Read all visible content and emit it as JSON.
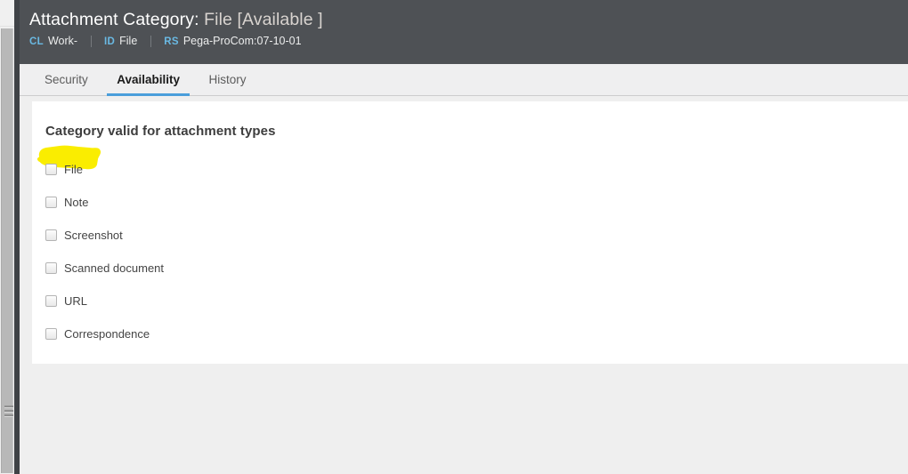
{
  "header": {
    "title_prefix": "Attachment Category:",
    "title_object": "File [Available ]",
    "meta": [
      {
        "key": "CL",
        "value": "Work-"
      },
      {
        "key": "ID",
        "value": "File"
      },
      {
        "key": "RS",
        "value": "Pega-ProCom:07-10-01"
      }
    ]
  },
  "tabs": [
    {
      "label": "Security",
      "active": false
    },
    {
      "label": "Availability",
      "active": true
    },
    {
      "label": "History",
      "active": false
    }
  ],
  "main": {
    "section_heading": "Category valid for attachment types",
    "attachment_types": [
      {
        "label": "File",
        "checked": false,
        "highlighted": true
      },
      {
        "label": "Note",
        "checked": false,
        "highlighted": false
      },
      {
        "label": "Screenshot",
        "checked": false,
        "highlighted": false
      },
      {
        "label": "Scanned document",
        "checked": false,
        "highlighted": false
      },
      {
        "label": "URL",
        "checked": false,
        "highlighted": false
      },
      {
        "label": "Correspondence",
        "checked": false,
        "highlighted": false
      }
    ]
  },
  "annotation": {
    "type": "marker-highlight",
    "color": "#faed00",
    "target": "File"
  },
  "colors": {
    "header_bg": "#4e5155",
    "accent_blue": "#4a9edb",
    "meta_key_blue": "#6ab9e3",
    "page_bg": "#efefef",
    "card_bg": "#ffffff",
    "highlight_yellow": "#faed00"
  }
}
